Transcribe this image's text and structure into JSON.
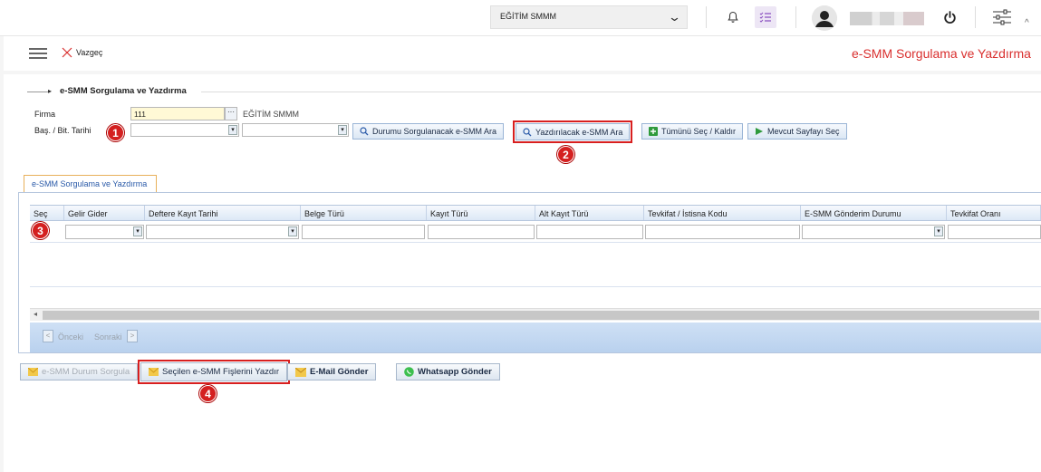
{
  "header": {
    "company": "EĞİTİM SMMM",
    "user_name_blurred": ""
  },
  "toolbar": {
    "cancel_label": "Vazgeç",
    "page_title": "e-SMM Sorgulama ve Yazdırma"
  },
  "form": {
    "section_title": "e-SMM Sorgulama ve Yazdırma",
    "firma_label": "Firma",
    "firma_value": "111",
    "firma_name": "EĞİTİM SMMM",
    "date_label": "Baş. / Bit. Tarihi",
    "btn_search_status": "Durumu Sorgulanacak e-SMM Ara",
    "btn_search_print": "Yazdırılacak e-SMM Ara",
    "btn_select_all": "Tümünü Seç / Kaldır",
    "btn_select_page": "Mevcut Sayfayı Seç"
  },
  "grid": {
    "tab_label": "e-SMM Sorgulama ve Yazdırma",
    "columns": [
      "Seç",
      "Gelir Gider",
      "Deftere Kayıt Tarihi",
      "Belge Türü",
      "Kayıt Türü",
      "Alt Kayıt Türü",
      "Tevkifat / İstisna Kodu",
      "E-SMM Gönderim Durumu",
      "Tevkifat Oranı"
    ],
    "pager_prev": "Önceki",
    "pager_next": "Sonraki"
  },
  "bottom": {
    "btn_query": "e-SMM Durum Sorgula",
    "btn_print": "Seçilen e-SMM Fişlerini Yazdır",
    "btn_email": "E-Mail Gönder",
    "btn_whatsapp": "Whatsapp Gönder"
  },
  "badges": [
    "1",
    "2",
    "3",
    "4"
  ],
  "colors": {
    "accent_red": "#d9302f",
    "highlight": "#d81f1f",
    "grid_header": "#dce8f6"
  }
}
